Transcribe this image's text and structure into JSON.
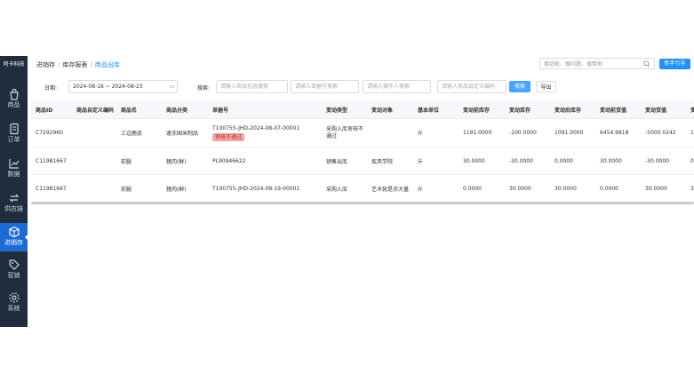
{
  "sidebar": {
    "brand": "阿卡科技",
    "items": [
      {
        "label": "商品",
        "icon": "bag-icon",
        "active": false
      },
      {
        "label": "订单",
        "icon": "document-icon",
        "active": false
      },
      {
        "label": "数据",
        "icon": "chart-icon",
        "active": false
      },
      {
        "label": "供应链",
        "icon": "exchange-icon",
        "active": false
      },
      {
        "label": "进销存",
        "icon": "cube-icon",
        "active": true
      },
      {
        "label": "营销",
        "icon": "tag-icon",
        "active": false
      },
      {
        "label": "系统",
        "icon": "gear-icon",
        "active": false
      }
    ]
  },
  "header": {
    "breadcrumb": [
      "进销存",
      "库存报表",
      "商品出库"
    ],
    "search_placeholder": "搜功能、搜问题、搜帮助",
    "new_button": "新手引导"
  },
  "filter": {
    "date_label": "日期:",
    "date_value": "2024-08-16 ~ 2024-08-23",
    "search_label": "搜索:",
    "placeholders": [
      "请输入商品信息搜索",
      "请输入单据号搜索",
      "请输入操作人搜索",
      "请输入商品自定义编码"
    ],
    "search_button": "搜索",
    "export_button": "导出"
  },
  "table": {
    "columns": [
      "商品ID",
      "商品自定义编码",
      "商品名",
      "商品分类",
      "单据号",
      "变动类型",
      "变动对象",
      "基本单位",
      "变动前库存",
      "变动库存",
      "变动后库存",
      "变动前货值",
      "变动货值",
      "变"
    ],
    "rows": [
      {
        "id": "C7292960",
        "code": "",
        "name": "三边鹿皮",
        "category": "速冻国米制品",
        "doc": "T100755-JHD-2024-08-07-00001",
        "tag": "审核不通过",
        "type": "采购入库审核不通过",
        "target": "",
        "unit": "斤",
        "before": "1191.0000",
        "change": "-100.0000",
        "after": "1091.0000",
        "value_before": "6454.9818",
        "value_change": "-5000.0242",
        "last": "1"
      },
      {
        "id": "C11981667",
        "code": "",
        "name": "前腿",
        "category": "猪肉(鲜)",
        "doc": "PL90946622",
        "tag": "",
        "type": "销售出库",
        "target": "疾风学院",
        "unit": "斤",
        "before": "30.0000",
        "change": "-30.0000",
        "after": "0.0000",
        "value_before": "30.0000",
        "value_change": "-30.0000",
        "last": "0"
      },
      {
        "id": "C11981667",
        "code": "",
        "name": "前腿",
        "category": "猪肉(鲜)",
        "doc": "T100755-JHD-2024-08-19-00001",
        "tag": "",
        "type": "采购入库",
        "target": "艺术就是浓大量",
        "unit": "斤",
        "before": "0.0000",
        "change": "30.0000",
        "after": "30.0000",
        "value_before": "0.0000",
        "value_change": "30.0000",
        "last": "3"
      }
    ]
  }
}
